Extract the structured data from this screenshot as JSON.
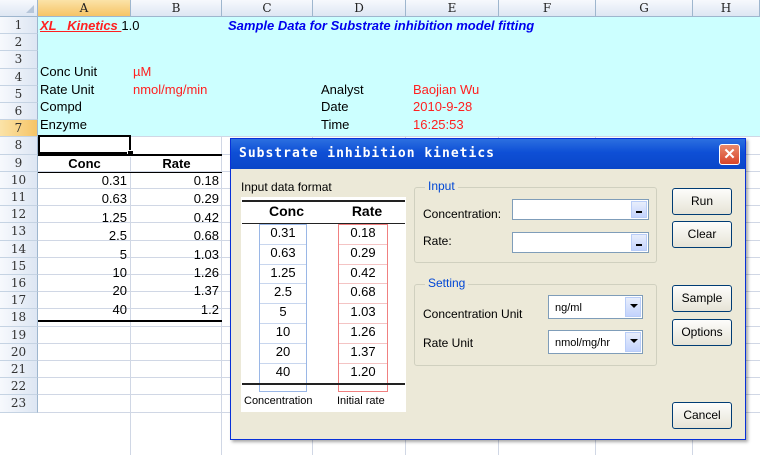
{
  "sheet": {
    "columns": [
      "A",
      "B",
      "C",
      "D",
      "E",
      "F",
      "G",
      "H"
    ],
    "rows": [
      "1",
      "2",
      "3",
      "4",
      "5",
      "6",
      "7",
      "8",
      "9",
      "10",
      "11",
      "12",
      "13",
      "14",
      "15",
      "16",
      "17",
      "18",
      "19",
      "20",
      "21",
      "22",
      "23"
    ],
    "title_xl": "XL _Kinetics ",
    "title_version": "1.0",
    "subtitle": "Sample Data for Substrate inhibition model fitting",
    "conc_unit_label": "Conc Unit",
    "conc_unit_value": "µM",
    "rate_unit_label": "Rate Unit",
    "rate_unit_value": "nmol/mg/min",
    "compd_label": "Compd",
    "enzyme_label": "Enzyme",
    "analyst_label": "Analyst",
    "analyst_value": "Baojian Wu",
    "date_label": "Date",
    "date_value": "2010-9-28",
    "time_label": "Time",
    "time_value": "16:25:53",
    "table_headers": [
      "Conc",
      "Rate"
    ],
    "table_rows": [
      [
        "0.31",
        "0.18"
      ],
      [
        "0.63",
        "0.29"
      ],
      [
        "1.25",
        "0.42"
      ],
      [
        "2.5",
        "0.68"
      ],
      [
        "5",
        "1.03"
      ],
      [
        "10",
        "1.26"
      ],
      [
        "20",
        "1.37"
      ],
      [
        "40",
        "1.2"
      ]
    ]
  },
  "dialog": {
    "title": "Substrate inhibition kinetics",
    "close_icon": "close-x-icon",
    "format_label": "Input data format",
    "format_headers": [
      "Conc",
      "Rate"
    ],
    "format_rows": [
      [
        "0.31",
        "0.18"
      ],
      [
        "0.63",
        "0.29"
      ],
      [
        "1.25",
        "0.42"
      ],
      [
        "2.5",
        "0.68"
      ],
      [
        "5",
        "1.03"
      ],
      [
        "10",
        "1.26"
      ],
      [
        "20",
        "1.37"
      ],
      [
        "40",
        "1.20"
      ]
    ],
    "format_caption_conc": "Concentration",
    "format_caption_rate": "Initial rate",
    "input_group": "Input",
    "concentration_label": "Concentration:",
    "concentration_value": "",
    "rate_label": "Rate:",
    "rate_value": "",
    "setting_group": "Setting",
    "conc_unit_label": "Concentration Unit",
    "conc_unit_selected": "ng/ml",
    "rate_unit_label": "Rate Unit",
    "rate_unit_selected": "nmol/mg/hr",
    "buttons": {
      "run": "Run",
      "clear": "Clear",
      "sample": "Sample",
      "options": "Options",
      "cancel": "Cancel"
    }
  },
  "colors": {
    "band": "#ccffff",
    "title_red": "#ff2020",
    "subtitle_blue": "#0000ee",
    "dialog_title_blue": "#0a46c8",
    "group_label_blue": "#0046d5"
  }
}
